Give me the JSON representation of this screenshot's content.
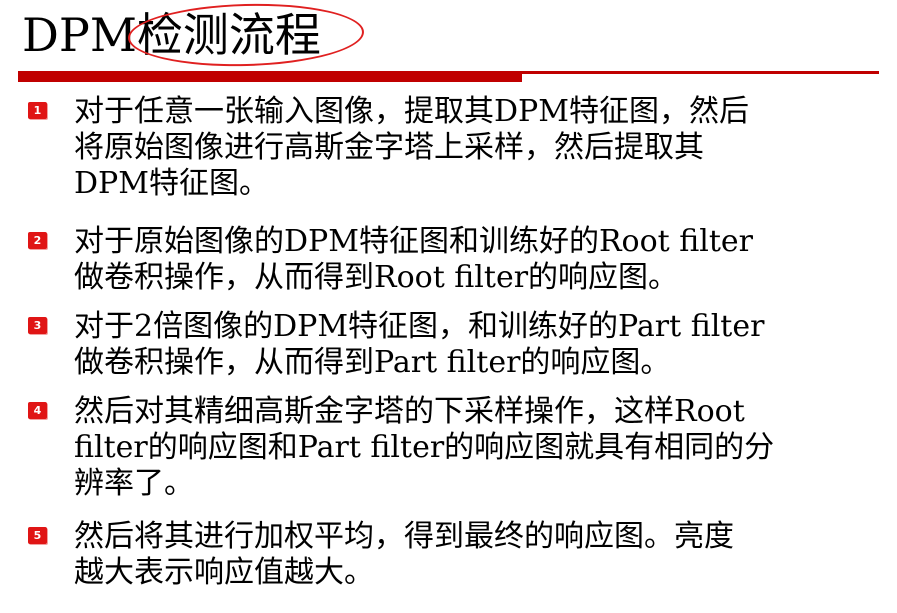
{
  "title": "DPM检测流程",
  "accent_color": "#c00000",
  "annotation_color": "#e02020",
  "bullets": [
    {
      "badge": "1",
      "text": "对于任意一张输入图像，提取其DPM特征图，然后\n将原始图像进行高斯金字塔上采样，然后提取其\nDPM特征图。"
    },
    {
      "badge": "2",
      "text": "对于原始图像的DPM特征图和训练好的Root filter\n做卷积操作，从而得到Root filter的响应图。"
    },
    {
      "badge": "3",
      "text": "对于2倍图像的DPM特征图，和训练好的Part filter\n做卷积操作，从而得到Part filter的响应图。"
    },
    {
      "badge": "4",
      "text": "然后对其精细高斯金字塔的下采样操作，这样Root\nfilter的响应图和Part filter的响应图就具有相同的分\n辨率了。"
    },
    {
      "badge": "5",
      "text": "然后将其进行加权平均，得到最终的响应图。亮度\n越大表示响应值越大。"
    }
  ]
}
